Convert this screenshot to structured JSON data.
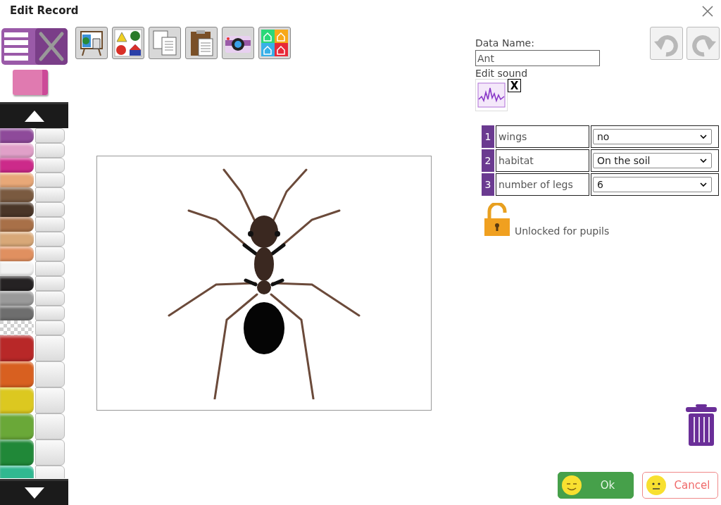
{
  "window": {
    "title": "Edit Record"
  },
  "pens": [
    {
      "color": "#8e4a9a",
      "large": false,
      "kind": "plain"
    },
    {
      "color": "#e0a0c8",
      "large": false,
      "kind": "plain"
    },
    {
      "color": "#cc2a8a",
      "large": false,
      "kind": "plain"
    },
    {
      "color": "#e8a878",
      "large": false,
      "kind": "plain"
    },
    {
      "color": "#7a5a40",
      "large": false,
      "kind": "plain"
    },
    {
      "color": "#4a3628",
      "large": false,
      "kind": "plain"
    },
    {
      "color": "#a87048",
      "large": false,
      "kind": "plain"
    },
    {
      "color": "#d8a878",
      "large": false,
      "kind": "plain"
    },
    {
      "color": "#e09060",
      "large": false,
      "kind": "plain"
    },
    {
      "color": "#f2f2f2",
      "large": false,
      "kind": "plain"
    },
    {
      "color": "#252223",
      "large": false,
      "kind": "plain"
    },
    {
      "color": "#9a9a9a",
      "large": false,
      "kind": "plain"
    },
    {
      "color": "#6e6e6e",
      "large": false,
      "kind": "plain"
    },
    {
      "color": "#d0d0d0",
      "large": false,
      "kind": "checkered"
    },
    {
      "color": "#b82828",
      "large": true,
      "kind": "plain"
    },
    {
      "color": "#d86020",
      "large": true,
      "kind": "plain"
    },
    {
      "color": "#dcc820",
      "large": true,
      "kind": "plain"
    },
    {
      "color": "#6aa838",
      "large": true,
      "kind": "plain"
    },
    {
      "color": "#208838",
      "large": true,
      "kind": "plain"
    },
    {
      "color": "#30b890",
      "large": true,
      "kind": "plain"
    }
  ],
  "history_buttons": [
    {
      "kind": "undo",
      "disabled": true
    },
    {
      "kind": "redo",
      "disabled": true
    }
  ],
  "data_name": {
    "label": "Data Name:",
    "value": "Ant"
  },
  "sound": {
    "label": "Edit sound",
    "remove": "X"
  },
  "fields": [
    {
      "number": "1",
      "name": "wings",
      "value": "no"
    },
    {
      "number": "2",
      "name": "habitat",
      "value": "On the soil"
    },
    {
      "number": "3",
      "name": "number of legs",
      "value": "6"
    }
  ],
  "lock": {
    "locked": false,
    "label": "Unlocked for pupils"
  },
  "buttons": {
    "ok": "Ok",
    "cancel": "Cancel"
  }
}
